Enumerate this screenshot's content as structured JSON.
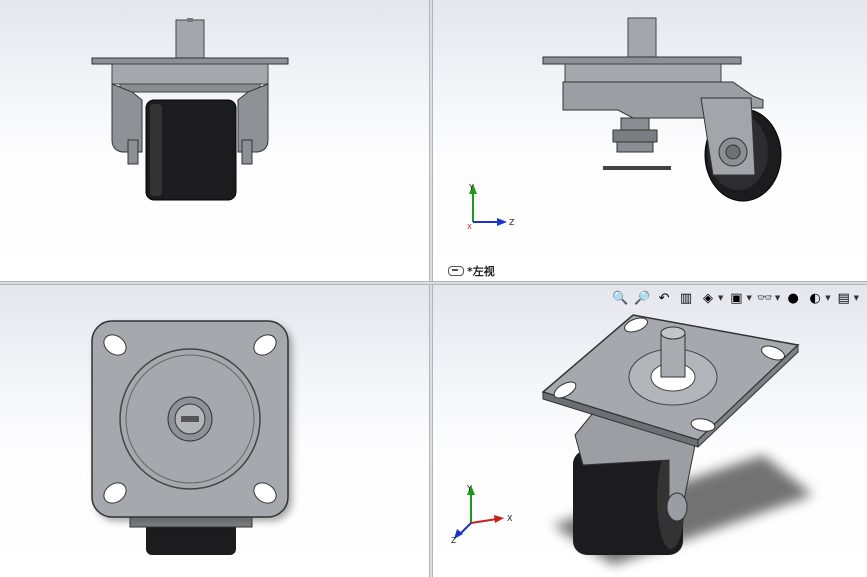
{
  "views": {
    "front": {
      "name": "front-view"
    },
    "left": {
      "name": "left-view",
      "label": "*左视"
    },
    "top": {
      "name": "top-view"
    },
    "iso": {
      "name": "isometric-view"
    }
  },
  "triads": {
    "left": {
      "y": "Y",
      "z": "Z",
      "x": "X"
    },
    "iso": {
      "y": "Y",
      "z": "Z",
      "x": "X"
    }
  },
  "toolbar": {
    "buttons": [
      "zoom-to-fit-icon",
      "zoom-to-area-icon",
      "previous-view-icon",
      "section-view-icon",
      "view-orientation-icon",
      "display-style-icon",
      "hide-show-items-icon",
      "edit-appearance-icon",
      "apply-scene-icon",
      "view-settings-icon"
    ]
  },
  "colors": {
    "metal": "#9a9da3",
    "metal_dark": "#5f6266",
    "rubber": "#1a1a1c",
    "axis_y": "#1c9a1c",
    "axis_z": "#1b35c8",
    "axis_x": "#c8201b"
  }
}
